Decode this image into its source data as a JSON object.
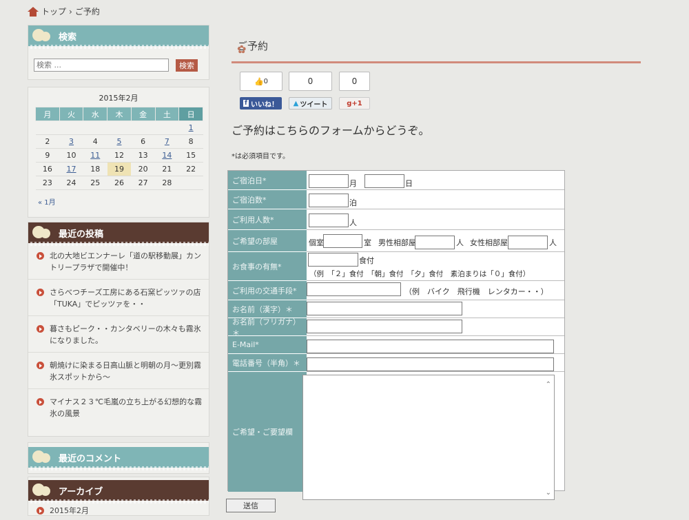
{
  "breadcrumb": {
    "home": "トップ",
    "sep": "›",
    "current": "ご予約"
  },
  "search": {
    "title": "検索",
    "placeholder": "検索 ...",
    "button": "検索"
  },
  "calendar": {
    "title": "2015年2月",
    "weekdays": [
      "月",
      "火",
      "水",
      "木",
      "金",
      "土",
      "日"
    ],
    "prev": "« 1月"
  },
  "recent_posts": {
    "title": "最近の投稿",
    "items": [
      "北の大地ビエンナーレ「道の駅移動展」カントリープラザで開催中！",
      "さらべつチーズ工房にある石窯ピッツァの店「TUKA」でピッツァを・・",
      "暮さもピーク・・カンタベリーの木々も霧氷になりました。",
      "朝焼けに染まる日高山脈と明朝の月～更別霧氷スポットから～",
      "マイナス２３℃毛嵐の立ち上がる幻想的な霧氷の風景"
    ]
  },
  "recent_comments": {
    "title": "最近のコメント"
  },
  "archive": {
    "title": "アーカイブ",
    "items": [
      "2015年2月"
    ]
  },
  "page": {
    "title": "ご予約",
    "intro": "ご予約はこちらのフォームからどうぞ。",
    "required_note": "*は必須項目です。"
  },
  "social": {
    "like_count": "0",
    "like_label": "いいね！",
    "tweet_count": "0",
    "tweet_label": "ツイート",
    "gplus_count": "0",
    "gplus_label": "+1"
  },
  "form": {
    "labels": {
      "date": "ご宿泊日*",
      "nights": "ご宿泊数*",
      "people": "ご利用人数*",
      "room": "ご希望の部屋",
      "meal": "お食事の有無*",
      "transport": "ご利用の交通手段*",
      "name_kanji": "お名前（漢字）＊",
      "name_kana": "お名前（フリガナ）＊",
      "email": "E-Mail*",
      "phone": "電話番号（半角）＊",
      "request": "ご希望・ご要望欄"
    },
    "units": {
      "month": "月",
      "day": "日",
      "nights": "泊",
      "people": "人",
      "private": "個室",
      "room": "室",
      "male": "男性相部屋",
      "person": "人",
      "female": "女性相部屋",
      "meal_unit": "食付"
    },
    "meal_example": "（例　「２」食付　「朝」食付　「夕」食付　素泊まりは「０」食付）",
    "transport_example": "（例　バイク　飛行機　レンタカー・・）",
    "submit": "送信"
  },
  "colors": {
    "teal": "#7fb5b6",
    "brown": "#5a3b31",
    "accent": "#c9503b"
  }
}
